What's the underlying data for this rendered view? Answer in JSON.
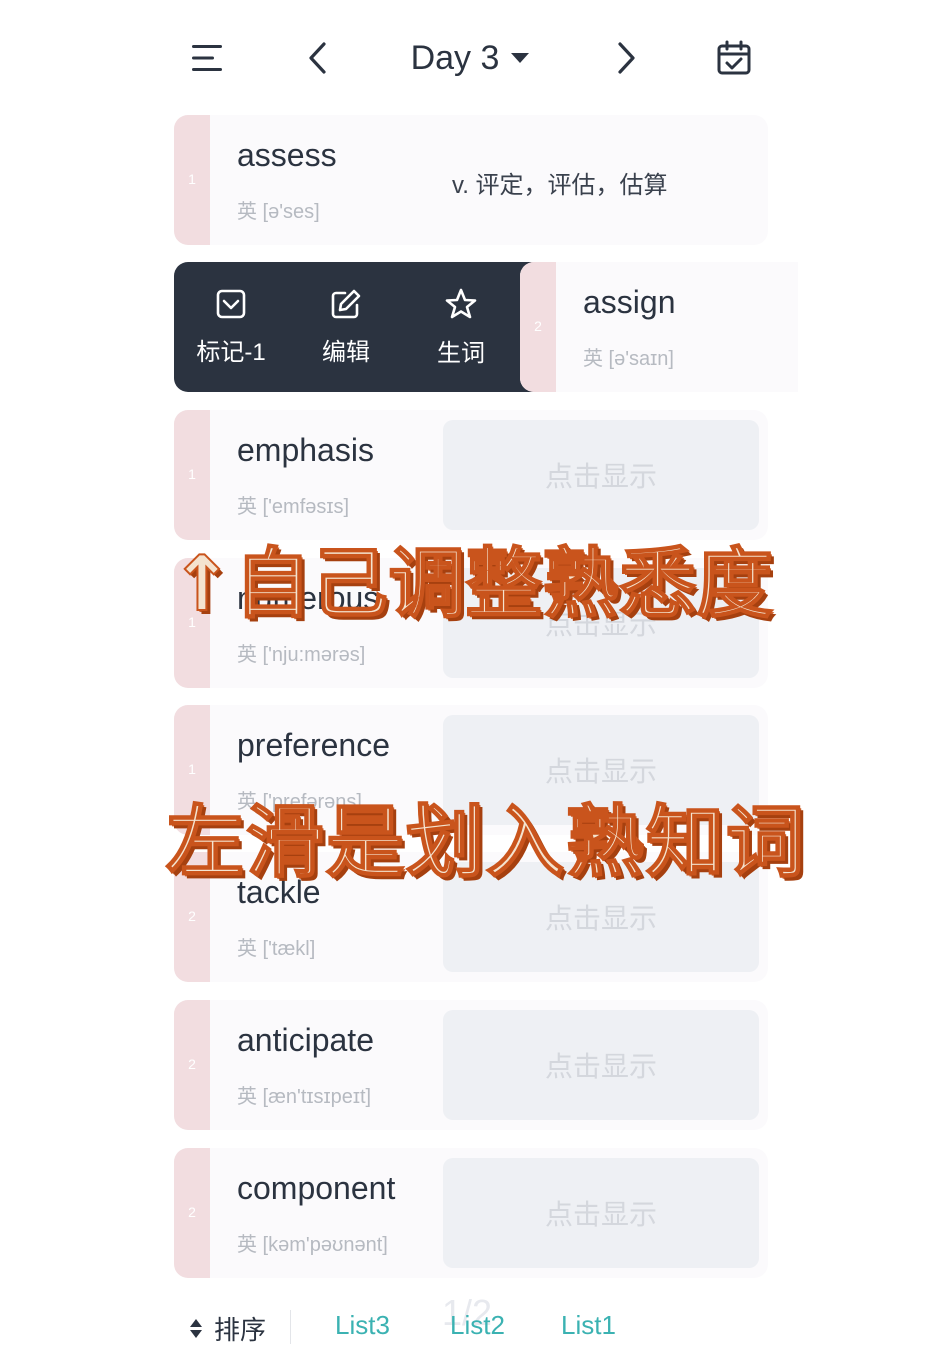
{
  "header": {
    "day_label": "Day 3"
  },
  "swiped": {
    "actions": [
      {
        "label": "标记-1",
        "icon": "checkbox-icon"
      },
      {
        "label": "编辑",
        "icon": "edit-icon"
      },
      {
        "label": "生词",
        "icon": "star-icon"
      }
    ],
    "card": {
      "num": "2",
      "word": "assign",
      "phonetic": "英 [ə'saɪn]"
    }
  },
  "cards": [
    {
      "num": "1",
      "word": "assess",
      "phonetic": "英 [ə'ses]",
      "meaning": "v. 评定，评估，估算"
    },
    {
      "num": "1",
      "word": "emphasis",
      "phonetic": "英 ['emfəsɪs]",
      "reveal": "点击显示"
    },
    {
      "num": "1",
      "word": "numerous",
      "phonetic": "英 ['nju:mərəs]",
      "reveal": "点击显示"
    },
    {
      "num": "1",
      "word": "preference",
      "phonetic": "英 ['prefərəns]",
      "reveal": "点击显示"
    },
    {
      "num": "2",
      "word": "tackle",
      "phonetic": "英 ['tækl]",
      "reveal": "点击显示"
    },
    {
      "num": "2",
      "word": "anticipate",
      "phonetic": "英 [æn'tɪsɪpeɪt]",
      "reveal": "点击显示"
    },
    {
      "num": "2",
      "word": "component",
      "phonetic": "英 [kəm'pəʊnənt]",
      "reveal": "点击显示"
    }
  ],
  "captions": {
    "top": "↑自己调整熟悉度",
    "bottom": "左滑是划入熟知词"
  },
  "bottom_bar": {
    "sort_label": "排序",
    "page": "1/2",
    "tabs": [
      "List3",
      "List2",
      "List1"
    ]
  },
  "colors": {
    "dark": "#2b3340",
    "strip": "#f2dde0",
    "accent": "#3bb2b2",
    "caption_stroke": "#c9541c"
  }
}
